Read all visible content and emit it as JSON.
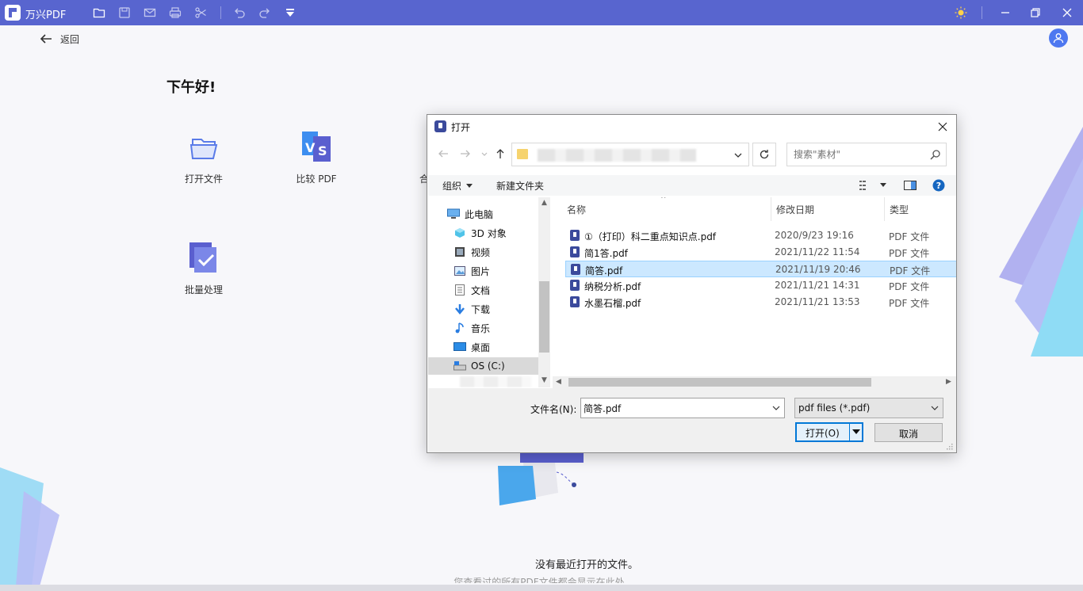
{
  "app": {
    "name": "万兴PDF"
  },
  "home": {
    "back_label": "返回",
    "greeting": "下午好!",
    "features": [
      {
        "label": "打开文件",
        "icon": "folder-open-icon"
      },
      {
        "label": "比较 PDF",
        "icon": "compare-pdf-icon"
      },
      {
        "label": "合并",
        "icon": "merge-pdf-icon"
      },
      {
        "label": "批量处理",
        "icon": "batch-process-icon"
      }
    ],
    "empty_title": "没有最近打开的文件。",
    "empty_subtitle": "您查看过的所有PDF文件都会显示在此处"
  },
  "dialog": {
    "title": "打开",
    "search_placeholder": "搜索\"素材\"",
    "toolbar": {
      "organize": "组织",
      "new_folder": "新建文件夹"
    },
    "nav": {
      "items": [
        {
          "label": "此电脑",
          "icon": "computer-icon"
        },
        {
          "label": "3D 对象",
          "icon": "cube-3d-icon"
        },
        {
          "label": "视频",
          "icon": "video-icon"
        },
        {
          "label": "图片",
          "icon": "picture-icon"
        },
        {
          "label": "文档",
          "icon": "document-icon"
        },
        {
          "label": "下载",
          "icon": "download-icon"
        },
        {
          "label": "音乐",
          "icon": "music-icon"
        },
        {
          "label": "桌面",
          "icon": "desktop-icon"
        },
        {
          "label": "OS (C:)",
          "icon": "drive-icon"
        }
      ],
      "selected_index": 8
    },
    "columns": {
      "name": "名称",
      "date": "修改日期",
      "type": "类型"
    },
    "files": [
      {
        "name": "①（打印）科二重点知识点.pdf",
        "date": "2020/9/23 19:16",
        "type": "PDF 文件"
      },
      {
        "name": "简1答.pdf",
        "date": "2021/11/22 11:54",
        "type": "PDF 文件"
      },
      {
        "name": "简答.pdf",
        "date": "2021/11/19 20:46",
        "type": "PDF 文件"
      },
      {
        "name": "纳税分析.pdf",
        "date": "2021/11/21 14:31",
        "type": "PDF 文件"
      },
      {
        "name": "水墨石榴.pdf",
        "date": "2021/11/21 13:53",
        "type": "PDF 文件"
      }
    ],
    "selected_file_index": 2,
    "filename_label": "文件名(N):",
    "filename_value": "简答.pdf",
    "filetype_value": "pdf files (*.pdf)",
    "open_label": "打开(O)",
    "cancel_label": "取消"
  },
  "colors": {
    "titlebar": "#5865cf",
    "accent": "#0078d7",
    "selection": "#cce8ff"
  }
}
